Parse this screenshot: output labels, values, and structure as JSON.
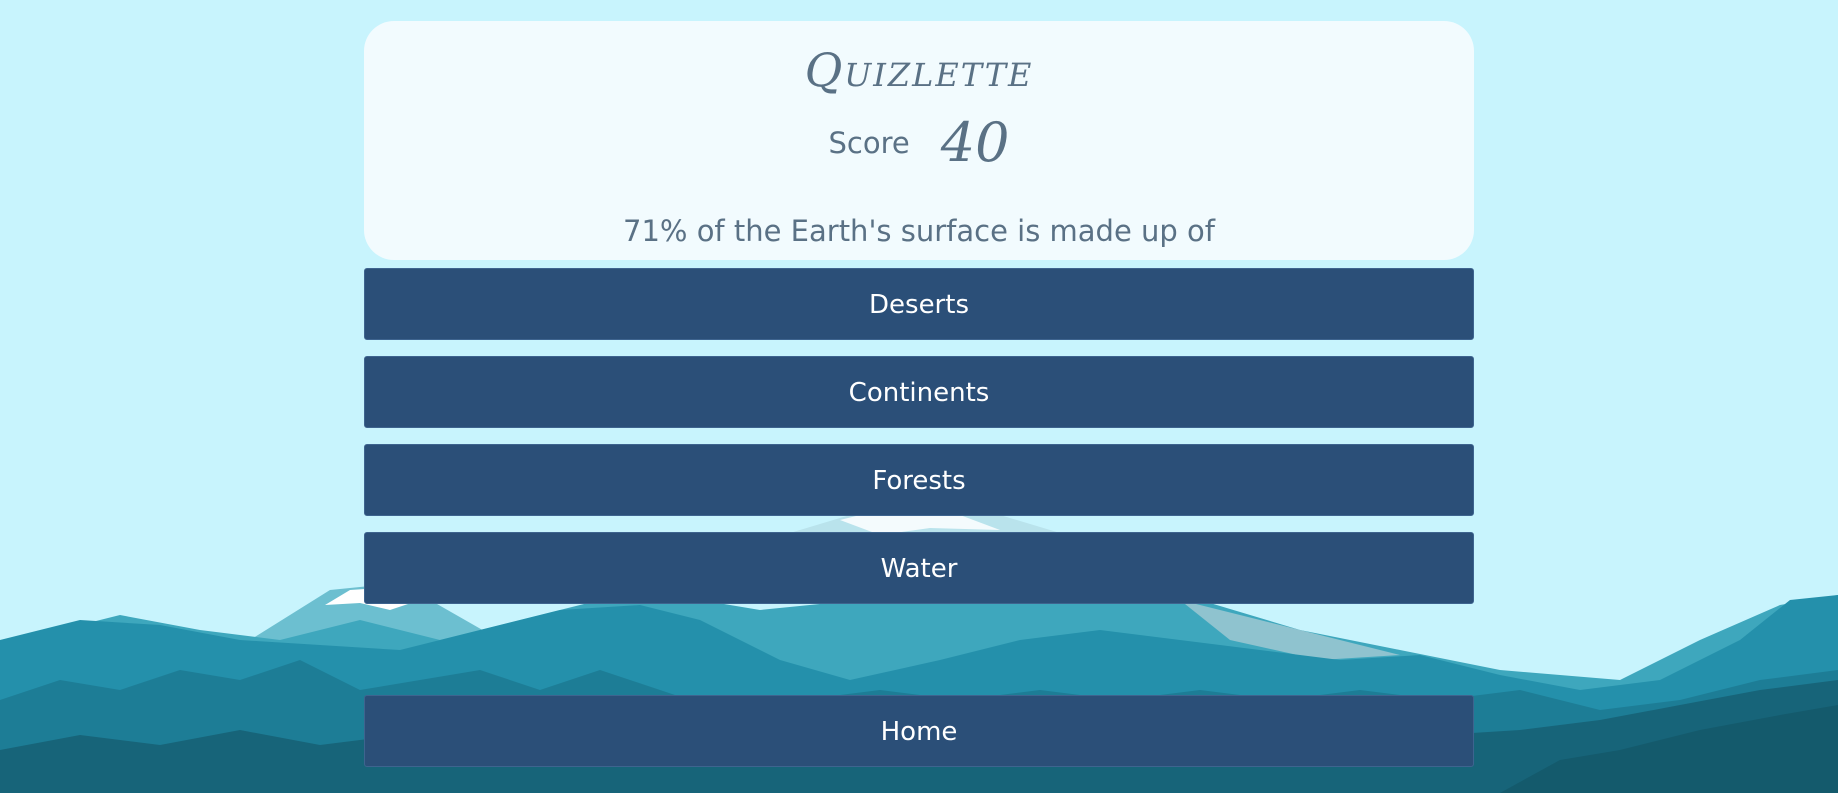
{
  "app": {
    "title": "Quizlette"
  },
  "score": {
    "label": "Score",
    "value": "40"
  },
  "question": {
    "text": "71% of the Earth's surface is made up of"
  },
  "answers": [
    {
      "label": "Deserts"
    },
    {
      "label": "Continents"
    },
    {
      "label": "Forests"
    },
    {
      "label": "Water"
    }
  ],
  "navigation": {
    "home_label": "Home"
  },
  "colors": {
    "sky": "#c8f4fd",
    "card": "#f2fbfe",
    "button": "#2b4f78",
    "text": "#5a7185"
  }
}
